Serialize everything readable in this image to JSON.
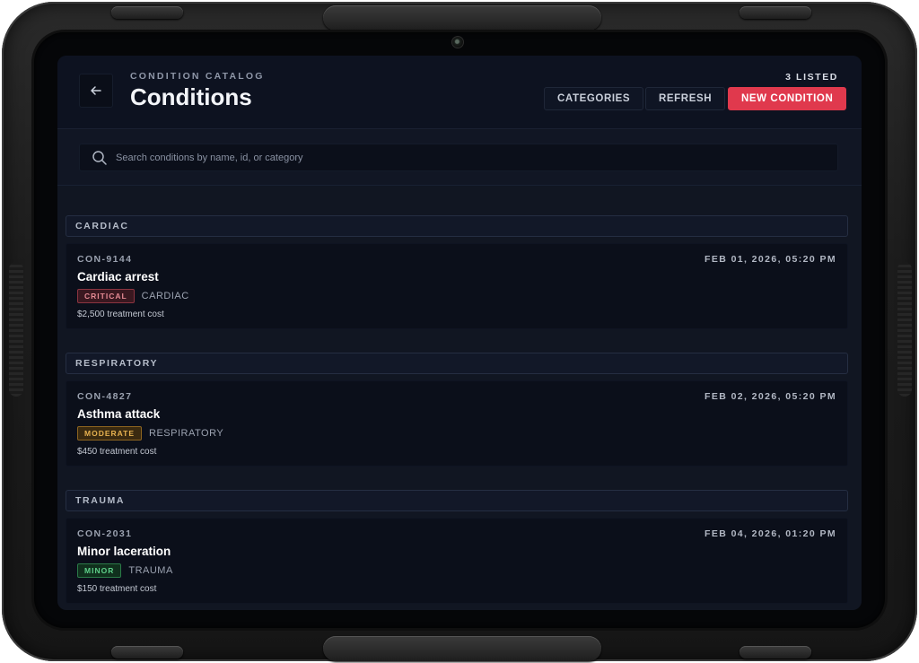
{
  "header": {
    "eyebrow": "CONDITION CATALOG",
    "title": "Conditions",
    "count_label": "3 LISTED",
    "back_icon": "arrow-left-icon",
    "buttons": {
      "categories": "CATEGORIES",
      "refresh": "REFRESH",
      "new_condition": "NEW CONDITION"
    },
    "accent_color": "#e0394d"
  },
  "search": {
    "placeholder": "Search conditions by name, id, or category",
    "value": "",
    "icon": "search-icon"
  },
  "groups": [
    {
      "label": "CARDIAC",
      "items": [
        {
          "id": "CON-9144",
          "date": "FEB 01, 2026, 05:20 PM",
          "name": "Cardiac arrest",
          "severity": "CRITICAL",
          "category": "CARDIAC",
          "cost": "$2,500 treatment cost"
        }
      ]
    },
    {
      "label": "RESPIRATORY",
      "items": [
        {
          "id": "CON-4827",
          "date": "FEB 02, 2026, 05:20 PM",
          "name": "Asthma attack",
          "severity": "MODERATE",
          "category": "RESPIRATORY",
          "cost": "$450 treatment cost"
        }
      ]
    },
    {
      "label": "TRAUMA",
      "items": [
        {
          "id": "CON-2031",
          "date": "FEB 04, 2026, 01:20 PM",
          "name": "Minor laceration",
          "severity": "MINOR",
          "category": "TRAUMA",
          "cost": "$150 treatment cost"
        }
      ]
    }
  ]
}
